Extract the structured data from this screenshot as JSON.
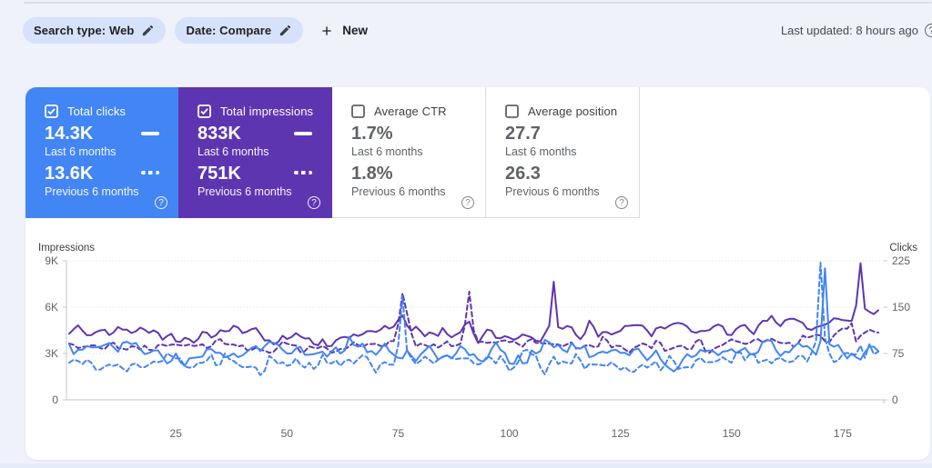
{
  "page": {
    "background": "#eff2fb",
    "bottom_strip_color": "#e4ebf8"
  },
  "header": {
    "chips": [
      {
        "label": "Search type: Web",
        "icon": "pencil-icon"
      },
      {
        "label": "Date: Compare",
        "icon": "pencil-icon"
      }
    ],
    "new_button": {
      "label": "New",
      "icon": "plus-icon"
    },
    "last_updated": "Last updated: 8 hours ago",
    "help_icon": "question-mark-icon"
  },
  "metric_cards": [
    {
      "id": "total-clicks",
      "title": "Total clicks",
      "checked": true,
      "accent": "#4285f4",
      "text_color": "#ffffff",
      "value_current": "14.3K",
      "label_current": "Last 6 months",
      "value_previous": "13.6K",
      "label_previous": "Previous 6 months"
    },
    {
      "id": "total-impressions",
      "title": "Total impressions",
      "checked": true,
      "accent": "#5e35b1",
      "text_color": "#ffffff",
      "value_current": "833K",
      "label_current": "Last 6 months",
      "value_previous": "751K",
      "label_previous": "Previous 6 months"
    },
    {
      "id": "average-ctr",
      "title": "Average CTR",
      "checked": false,
      "accent": "#ffffff",
      "text_color": "#5f6368",
      "value_current": "1.7%",
      "label_current": "Last 6 months",
      "value_previous": "1.8%",
      "label_previous": "Previous 6 months"
    },
    {
      "id": "average-position",
      "title": "Average position",
      "checked": false,
      "accent": "#ffffff",
      "text_color": "#5f6368",
      "value_current": "27.7",
      "label_current": "Last 6 months",
      "value_previous": "26.3",
      "label_previous": "Previous 6 months"
    }
  ],
  "chart_data": {
    "type": "line",
    "x": {
      "domain": [
        1,
        183
      ],
      "ticks": [
        25,
        50,
        75,
        100,
        125,
        150,
        175
      ]
    },
    "y_left": {
      "title": "Impressions",
      "max": 9000,
      "ticks": [
        {
          "v": 9000,
          "label": "9K"
        },
        {
          "v": 6000,
          "label": "6K"
        },
        {
          "v": 3000,
          "label": "3K"
        },
        {
          "v": 0,
          "label": "0"
        }
      ]
    },
    "y_right": {
      "title": "Clicks",
      "max": 225,
      "ticks": [
        {
          "v": 225,
          "label": "225"
        },
        {
          "v": 150,
          "label": "150"
        },
        {
          "v": 75,
          "label": "75"
        },
        {
          "v": 0,
          "label": "0"
        }
      ]
    },
    "grid": "dotted-horizontal",
    "legend_position": "none",
    "series": [
      {
        "name": "Impressions - Previous 6 months",
        "axis": "left",
        "style": "dashed",
        "color": "#5e35b1",
        "values": [
          3648,
          3556,
          3345,
          3429,
          3457,
          3526,
          3524,
          3336,
          3292,
          3601,
          3705,
          3351,
          3323,
          3247,
          3463,
          3444,
          3247,
          3511,
          3241,
          3205,
          3539,
          3572,
          3489,
          3575,
          3585,
          3527,
          3513,
          3577,
          3487,
          3525,
          3597,
          3351,
          3473,
          3850,
          3928,
          3625,
          3582,
          3582,
          3461,
          3523,
          3216,
          3218,
          3380,
          3248,
          3176,
          3054,
          3115,
          3420,
          3762,
          3638,
          3551,
          3511,
          3097,
          3146,
          3459,
          3375,
          3351,
          3483,
          3323,
          3045,
          3131,
          3302,
          3285,
          3449,
          3733,
          3547,
          3413,
          3602,
          3611,
          3632,
          3492,
          3459,
          3794,
          3813,
          4900,
          6900,
          5600,
          4300,
          3461,
          3632,
          3551,
          3423,
          3602,
          3385,
          3564,
          3784,
          3473,
          3518,
          3628,
          4800,
          7000,
          4500,
          3764,
          3758,
          3685,
          3732,
          3703,
          3803,
          3854,
          3738,
          3792,
          3610,
          3441,
          3789,
          3928,
          3680,
          3677,
          3645,
          3631,
          3599,
          3591,
          3460,
          3594,
          3728,
          3325,
          3353,
          3506,
          3545,
          3429,
          3450,
          4082,
          3843,
          3387,
          3505,
          3474,
          3259,
          3066,
          3361,
          3500,
          3649,
          3549,
          3342,
          3821,
          3686,
          3164,
          3256,
          3366,
          3479,
          3499,
          3279,
          3303,
          3775,
          3933,
          3217,
          3042,
          3317,
          3439,
          3553,
          3750,
          3920,
          3801,
          3723,
          3620,
          3665,
          3870,
          3921,
          3725,
          3851,
          3950,
          3795,
          3689,
          3650,
          3698,
          3425,
          3675,
          4156,
          4017,
          4108,
          4223,
          4157,
          3790,
          3733,
          4163,
          4436,
          4636,
          4600,
          4950,
          3781,
          4150,
          4354,
          4550,
          4421,
          4350
        ]
      },
      {
        "name": "Impressions - Last 6 months",
        "axis": "left",
        "style": "solid",
        "color": "#5e35b1",
        "values": [
          4277,
          4568,
          4826,
          4470,
          4183,
          4196,
          4385,
          4492,
          4540,
          4191,
          4363,
          4719,
          4545,
          4539,
          4326,
          4443,
          4678,
          4538,
          4333,
          4500,
          4343,
          3889,
          4126,
          4277,
          3796,
          3748,
          4020,
          3925,
          3702,
          3933,
          4401,
          4345,
          4028,
          4178,
          4514,
          4434,
          4464,
          4792,
          4682,
          4322,
          4410,
          4569,
          4648,
          4262,
          3835,
          3859,
          3591,
          3739,
          4150,
          3934,
          4058,
          4318,
          4111,
          3973,
          3991,
          3611,
          3528,
          3922,
          3478,
          3480,
          3855,
          4026,
          4077,
          4003,
          4239,
          4137,
          4245,
          4443,
          4454,
          4393,
          4532,
          4790,
          4610,
          4743,
          5170,
          5459,
          4814,
          4473,
          4735,
          4451,
          4112,
          4357,
          4287,
          4135,
          4653,
          4266,
          4048,
          4223,
          4376,
          4862,
          5065,
          4270,
          3670,
          4130,
          4545,
          4480,
          4009,
          3981,
          4126,
          4027,
          3887,
          4011,
          4227,
          4140,
          4046,
          3821,
          3783,
          4297,
          4800,
          7650,
          4700,
          4601,
          4776,
          4702,
          4208,
          3925,
          4301,
          5122,
          4709,
          4081,
          4391,
          4380,
          4230,
          4348,
          4463,
          4782,
          4795,
          4832,
          4836,
          4802,
          4495,
          4112,
          4625,
          4715,
          4611,
          4802,
          4934,
          4980,
          4917,
          4739,
          4418,
          4340,
          4455,
          4461,
          4519,
          4751,
          4878,
          4750,
          4222,
          4196,
          4575,
          4782,
          4845,
          4503,
          4253,
          4797,
          5113,
          5110,
          5442,
          5003,
          4773,
          5143,
          5241,
          5250,
          5119,
          4981,
          4602,
          4529,
          4698,
          4784,
          4872,
          5003,
          5283,
          5239,
          5156,
          5129,
          5100,
          6100,
          8850,
          5900,
          5700,
          5550,
          5800
        ]
      },
      {
        "name": "Clicks - Previous 6 months",
        "axis": "right",
        "style": "dashed",
        "color": "#4285f4",
        "values": [
          60,
          65,
          63,
          58,
          65,
          60,
          49,
          49,
          54,
          57,
          55,
          57,
          51,
          46,
          57,
          59,
          53,
          53,
          57,
          62,
          61,
          63,
          75,
          71,
          67,
          67,
          54,
          52,
          53,
          60,
          60,
          64,
          73,
          56,
          57,
          75,
          66,
          63,
          57,
          53,
          53,
          54,
          52,
          40,
          47,
          71,
          66,
          58,
          61,
          55,
          57,
          67,
          57,
          52,
          60,
          50,
          56,
          73,
          60,
          59,
          64,
          55,
          63,
          65,
          59,
          66,
          72,
          69,
          56,
          44,
          57,
          61,
          57,
          57,
          88,
          168,
          80,
          67,
          58,
          63,
          70,
          65,
          59,
          65,
          69,
          72,
          68,
          66,
          67,
          67,
          67,
          59,
          57,
          60,
          71,
          67,
          59,
          71,
          61,
          47,
          52,
          61,
          79,
          81,
          74,
          71,
          52,
          41,
          58,
          70,
          58,
          62,
          60,
          59,
          74,
          64,
          50,
          58,
          57,
          57,
          56,
          55,
          61,
          55,
          49,
          53,
          47,
          45,
          52,
          57,
          52,
          57,
          62,
          48,
          56,
          71,
          63,
          50,
          52,
          53,
          52,
          64,
          68,
          61,
          61,
          61,
          64,
          69,
          64,
          60,
          75,
          77,
          64,
          73,
          75,
          60,
          63,
          65,
          59,
          66,
          68,
          63,
          61,
          63,
          71,
          71,
          62,
          76,
          95,
          222,
          100,
          75,
          61,
          64,
          74,
          76,
          73,
          74,
          88,
          68,
          90,
          74,
          78
        ]
      },
      {
        "name": "Clicks - Last 6 months",
        "axis": "right",
        "style": "solid",
        "color": "#4285f4",
        "values": [
          90,
          74,
          81,
          81,
          87,
          85,
          85,
          86,
          89,
          92,
          85,
          78,
          92,
          94,
          90,
          92,
          82,
          74,
          76,
          80,
          80,
          69,
          59,
          63,
          75,
          61,
          55,
          67,
          68,
          69,
          70,
          82,
          82,
          76,
          76,
          69,
          71,
          75,
          69,
          72,
          78,
          84,
          87,
          79,
          87,
          94,
          92,
          89,
          81,
          75,
          75,
          83,
          86,
          73,
          73,
          74,
          76,
          78,
          70,
          78,
          85,
          75,
          80,
          102,
          89,
          86,
          91,
          77,
          79,
          73,
          81,
          91,
          79,
          73,
          68,
          67,
          80,
          71,
          63,
          73,
          80,
          87,
          77,
          65,
          70,
          72,
          67,
          75,
          87,
          82,
          72,
          74,
          65,
          62,
          67,
          82,
          93,
          81,
          76,
          59,
          58,
          72,
          59,
          60,
          80,
          75,
          79,
          97,
          93,
          85,
          89,
          81,
          77,
          92,
          84,
          83,
          87,
          69,
          71,
          76,
          78,
          76,
          80,
          81,
          76,
          76,
          72,
          81,
          83,
          73,
          64,
          71,
          80,
          66,
          57,
          51,
          46,
          52,
          65,
          74,
          69,
          72,
          81,
          78,
          80,
          78,
          72,
          78,
          79,
          82,
          76,
          80,
          84,
          75,
          73,
          78,
          94,
          97,
          95,
          80,
          71,
          78,
          77,
          86,
          92,
          86,
          87,
          81,
          73,
          95,
          213,
          90,
          86,
          89,
          77,
          67,
          75,
          69,
          65,
          77,
          86,
          86,
          79
        ]
      }
    ]
  }
}
